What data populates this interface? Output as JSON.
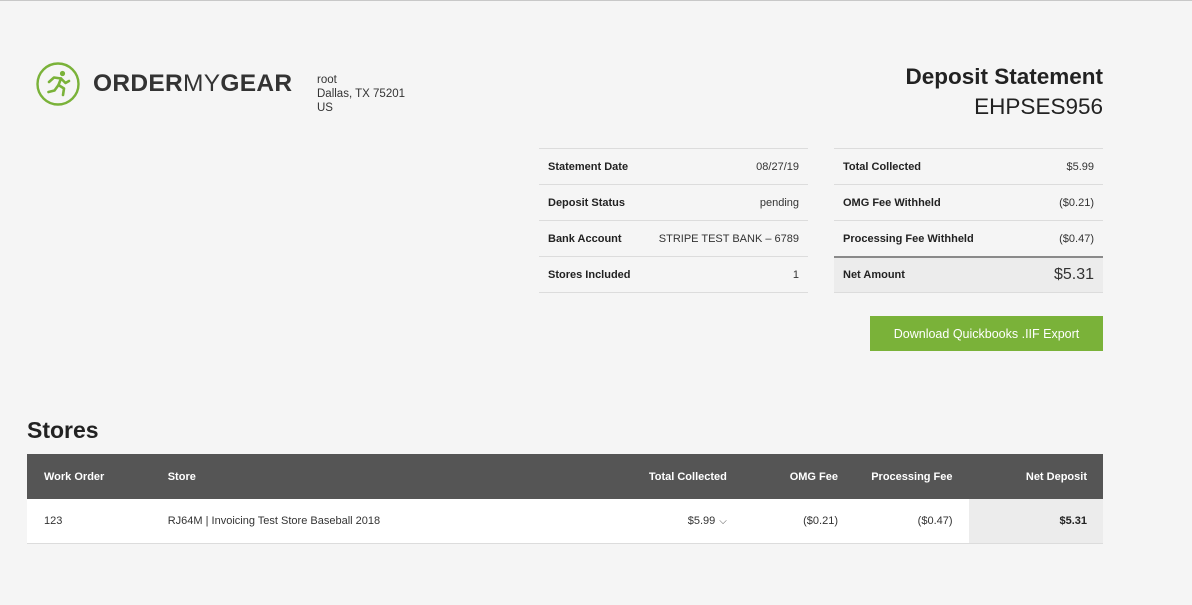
{
  "brand": {
    "name_bold": "ORDER",
    "name_light": "MY",
    "name_bold2": "GEAR",
    "accent_color": "#7ab239"
  },
  "address": {
    "line1": "root",
    "line2": "Dallas, TX 75201",
    "line3": "US"
  },
  "statement": {
    "title": "Deposit Statement",
    "id": "EHPSES956"
  },
  "details": [
    {
      "label": "Statement Date",
      "value": "08/27/19"
    },
    {
      "label": "Deposit Status",
      "value": "pending"
    },
    {
      "label": "Bank Account",
      "value": "STRIPE TEST BANK – 6789"
    },
    {
      "label": "Stores Included",
      "value": "1"
    }
  ],
  "totals": [
    {
      "label": "Total Collected",
      "value": "$5.99"
    },
    {
      "label": "OMG Fee Withheld",
      "value": "($0.21)"
    },
    {
      "label": "Processing Fee Withheld",
      "value": "($0.47)"
    },
    {
      "label": "Net Amount",
      "value": "$5.31"
    }
  ],
  "download_label": "Download Quickbooks .IIF Export",
  "stores": {
    "title": "Stores",
    "columns": {
      "work_order": "Work Order",
      "store": "Store",
      "total_collected": "Total Collected",
      "omg_fee": "OMG Fee",
      "processing_fee": "Processing Fee",
      "net_deposit": "Net Deposit"
    },
    "rows": [
      {
        "work_order": "123",
        "store": "RJ64M | Invoicing Test Store Baseball 2018",
        "total_collected": "$5.99",
        "omg_fee": "($0.21)",
        "processing_fee": "($0.47)",
        "net_deposit": "$5.31"
      }
    ]
  }
}
